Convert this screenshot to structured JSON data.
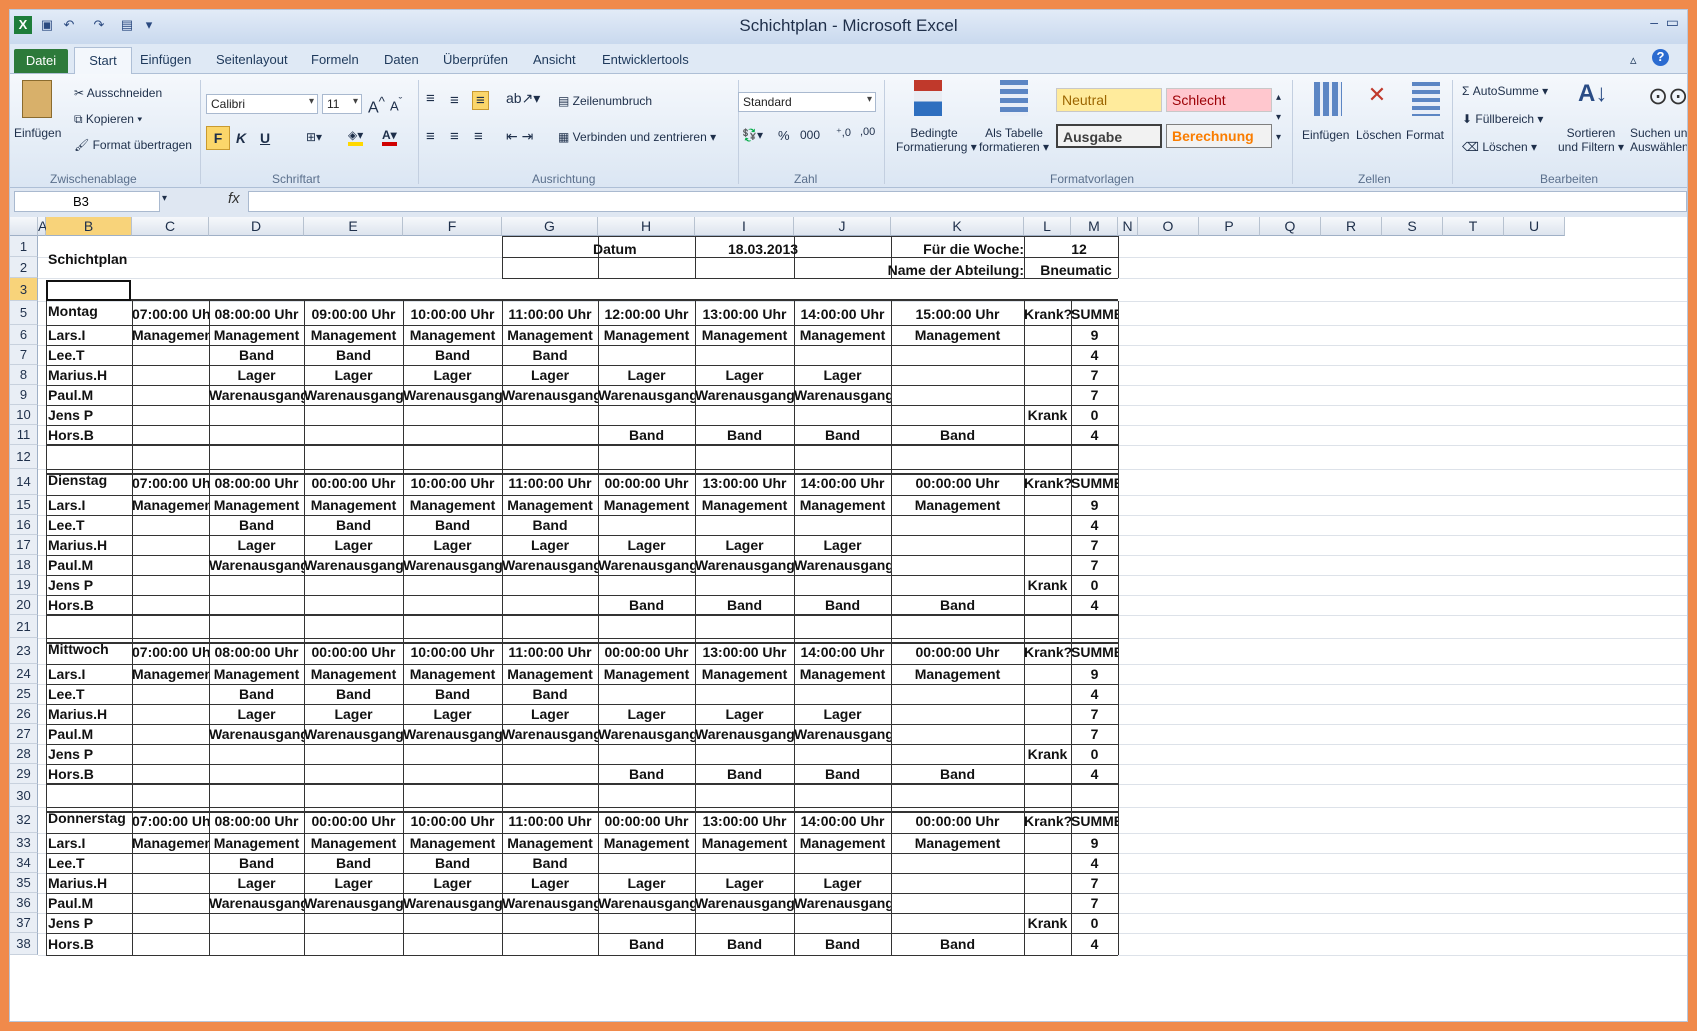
{
  "window": {
    "title": "Schichtplan - Microsoft Excel"
  },
  "tabs": [
    "Datei",
    "Start",
    "Einfügen",
    "Seitenlayout",
    "Formeln",
    "Daten",
    "Überprüfen",
    "Ansicht",
    "Entwicklertools"
  ],
  "ribbon": {
    "clipboard": {
      "paste": "Einfügen",
      "cut": "Ausschneiden",
      "copy": "Kopieren",
      "format_painter": "Format übertragen",
      "group": "Zwischenablage"
    },
    "font": {
      "name": "Calibri",
      "size": "11",
      "bold": "F",
      "italic": "K",
      "underline": "U",
      "group": "Schriftart"
    },
    "alignment": {
      "wrap": "Zeilenumbruch",
      "merge": "Verbinden und zentrieren",
      "group": "Ausrichtung"
    },
    "number": {
      "format": "Standard",
      "percent": "%",
      "thousands": "000",
      "group": "Zahl"
    },
    "styles": {
      "conditional": [
        "Bedingte",
        "Formatierung"
      ],
      "as_table": [
        "Als Tabelle",
        "formatieren"
      ],
      "neutral": "Neutral",
      "bad": "Schlecht",
      "output": "Ausgabe",
      "calc": "Berechnung",
      "group": "Formatvorlagen"
    },
    "cells": {
      "insert": "Einfügen",
      "delete": "Löschen",
      "format": "Format",
      "group": "Zellen"
    },
    "editing": {
      "autosum": "AutoSumme",
      "fill": "Füllbereich",
      "clear": "Löschen",
      "sort": [
        "Sortieren",
        "und Filtern"
      ],
      "find": [
        "Suchen und",
        "Auswählen"
      ],
      "group": "Bearbeiten"
    },
    "colors": {
      "neutral_bg": "#ffeb9c",
      "bad_bg": "#ffc7ce",
      "bad_fg": "#9c0006",
      "neutral_fg": "#9c6500",
      "calc_fg": "#fa7d00",
      "accent_green": "#2d7a3a"
    }
  },
  "formula_bar": {
    "name_box": "B3",
    "fx": "fx",
    "value": ""
  },
  "columns": [
    "A",
    "B",
    "C",
    "D",
    "E",
    "F",
    "G",
    "H",
    "I",
    "J",
    "K",
    "L",
    "M",
    "N",
    "O",
    "P",
    "Q",
    "R",
    "S",
    "T",
    "U"
  ],
  "sheet": {
    "title": "Schichtplan",
    "date_label": "Datum",
    "date_value": "18.03.2013",
    "week_label": "Für die Woche:",
    "week_value": "12",
    "dept_label": "Name der Abteilung:",
    "dept_value": "Bneumatic",
    "blocks": [
      {
        "day": "Montag",
        "rows": [
          "5",
          "6",
          "7",
          "8",
          "9",
          "10",
          "11",
          "12"
        ],
        "times": [
          "07:00:00 Uhr",
          "08:00:00 Uhr",
          "09:00:00 Uhr",
          "10:00:00 Uhr",
          "11:00:00 Uhr",
          "12:00:00 Uhr",
          "13:00:00 Uhr",
          "14:00:00 Uhr",
          "15:00:00 Uhr"
        ]
      },
      {
        "day": "Dienstag",
        "rows": [
          "14",
          "15",
          "16",
          "17",
          "18",
          "19",
          "20",
          "21"
        ],
        "times": [
          "07:00:00 Uhr",
          "08:00:00 Uhr",
          "00:00:00 Uhr",
          "10:00:00 Uhr",
          "11:00:00 Uhr",
          "00:00:00 Uhr",
          "13:00:00 Uhr",
          "14:00:00 Uhr",
          "00:00:00 Uhr"
        ]
      },
      {
        "day": "Mittwoch",
        "rows": [
          "23",
          "24",
          "25",
          "26",
          "27",
          "28",
          "29",
          "30"
        ],
        "times": [
          "07:00:00 Uhr",
          "08:00:00 Uhr",
          "00:00:00 Uhr",
          "10:00:00 Uhr",
          "11:00:00 Uhr",
          "00:00:00 Uhr",
          "13:00:00 Uhr",
          "14:00:00 Uhr",
          "00:00:00 Uhr"
        ]
      },
      {
        "day": "Donnerstag",
        "rows": [
          "32",
          "33",
          "34",
          "35",
          "36",
          "37",
          "38"
        ],
        "times": [
          "07:00:00 Uhr",
          "08:00:00 Uhr",
          "00:00:00 Uhr",
          "10:00:00 Uhr",
          "11:00:00 Uhr",
          "00:00:00 Uhr",
          "13:00:00 Uhr",
          "14:00:00 Uhr",
          "00:00:00 Uhr"
        ]
      }
    ],
    "krank_header": "Krank?",
    "summe_header": "SUMME",
    "staff": [
      {
        "name": "Lars.I",
        "cells": [
          "Managemen",
          "Management",
          "Management",
          "Management",
          "Management",
          "Management",
          "Management",
          "Management",
          "Management"
        ],
        "krank": "",
        "sum": "9"
      },
      {
        "name": "Lee.T",
        "cells": [
          "",
          "Band",
          "Band",
          "Band",
          "Band",
          "",
          "",
          "",
          ""
        ],
        "krank": "",
        "sum": "4"
      },
      {
        "name": "Marius.H",
        "cells": [
          "",
          "Lager",
          "Lager",
          "Lager",
          "Lager",
          "Lager",
          "Lager",
          "Lager",
          ""
        ],
        "krank": "",
        "sum": "7"
      },
      {
        "name": "Paul.M",
        "cells": [
          "",
          "Warenausgang",
          "Warenausgang",
          "Warenausgang",
          "Warenausgang",
          "Warenausgang",
          "Warenausgang",
          "Warenausgang",
          ""
        ],
        "krank": "",
        "sum": "7"
      },
      {
        "name": "Jens P",
        "cells": [
          "",
          "",
          "",
          "",
          "",
          "",
          "",
          "",
          ""
        ],
        "krank": "Krank",
        "sum": "0"
      },
      {
        "name": "Hors.B",
        "cells": [
          "",
          "",
          "",
          "",
          "",
          "Band",
          "Band",
          "Band",
          "Band"
        ],
        "krank": "",
        "sum": "4"
      }
    ]
  }
}
